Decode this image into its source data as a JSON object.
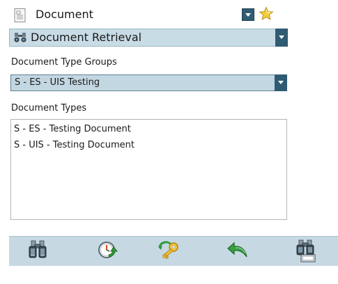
{
  "header": {
    "section_label": "Document",
    "section_icon": "document-icon",
    "favorite_icon": "star-icon"
  },
  "retrieval": {
    "label": "Document Retrieval",
    "icon": "binoculars-icon"
  },
  "form": {
    "group_label": "Document Type Groups",
    "group_value": "S - ES - UIS Testing",
    "types_label": "Document Types",
    "types": [
      "S - ES - Testing Document",
      "S - UIS - Testing Document"
    ]
  },
  "toolbar": {
    "buttons": [
      {
        "icon": "binoculars-search-icon",
        "selected": true
      },
      {
        "icon": "clock-refresh-icon",
        "selected": false
      },
      {
        "icon": "key-icon",
        "selected": false
      },
      {
        "icon": "undo-arrow-icon",
        "selected": false
      },
      {
        "icon": "binoculars-id-search-icon",
        "selected": false
      }
    ]
  },
  "colors": {
    "accent": "#2f5b73",
    "bar_fill": "#c8dce6",
    "selection_border": "#b3121b"
  }
}
